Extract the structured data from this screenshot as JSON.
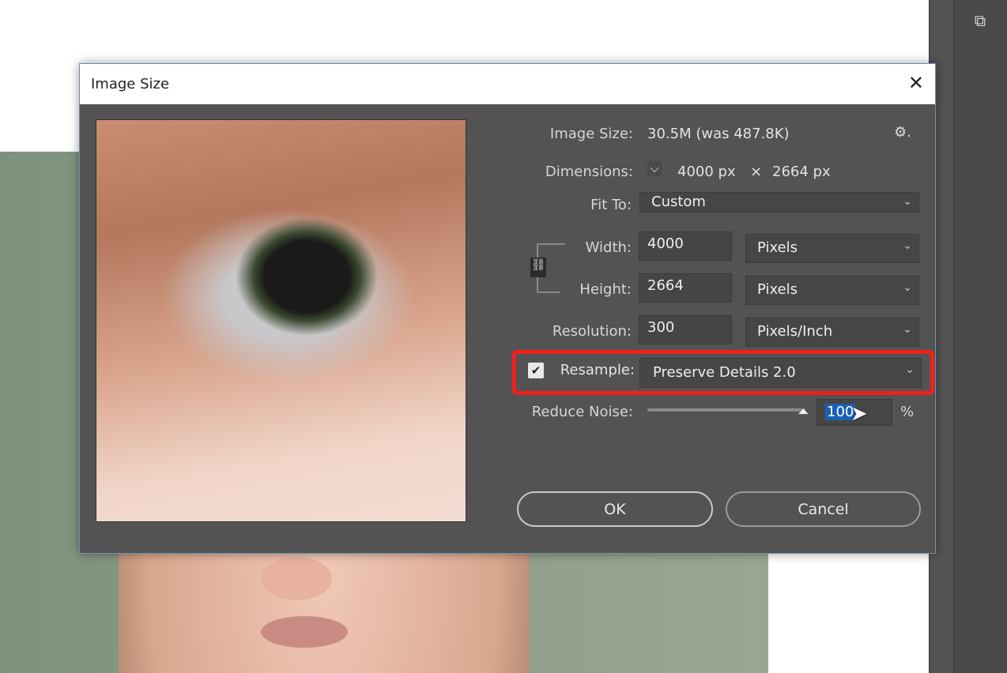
{
  "dialog": {
    "title": "Image Size",
    "close_icon": "close-icon"
  },
  "info": {
    "image_size_label": "Image Size:",
    "image_size_value": "30.5M (was 487.8K)",
    "dimensions_label": "Dimensions:",
    "dim_width": "4000 px",
    "dim_sep": "×",
    "dim_height": "2664 px"
  },
  "fit_to": {
    "label": "Fit To:",
    "value": "Custom"
  },
  "width": {
    "label": "Width:",
    "value": "4000",
    "unit": "Pixels"
  },
  "height": {
    "label": "Height:",
    "value": "2664",
    "unit": "Pixels"
  },
  "resolution": {
    "label": "Resolution:",
    "value": "300",
    "unit": "Pixels/Inch"
  },
  "resample": {
    "label": "Resample:",
    "checked": true,
    "value": "Preserve Details 2.0"
  },
  "reduce_noise": {
    "label": "Reduce Noise:",
    "value": "100",
    "unit": "%",
    "slider_percent": 100
  },
  "buttons": {
    "ok": "OK",
    "cancel": "Cancel"
  },
  "colors": {
    "highlight": "#f0201c",
    "dialog_bg": "#535353",
    "selection": "#1a5fb4"
  }
}
